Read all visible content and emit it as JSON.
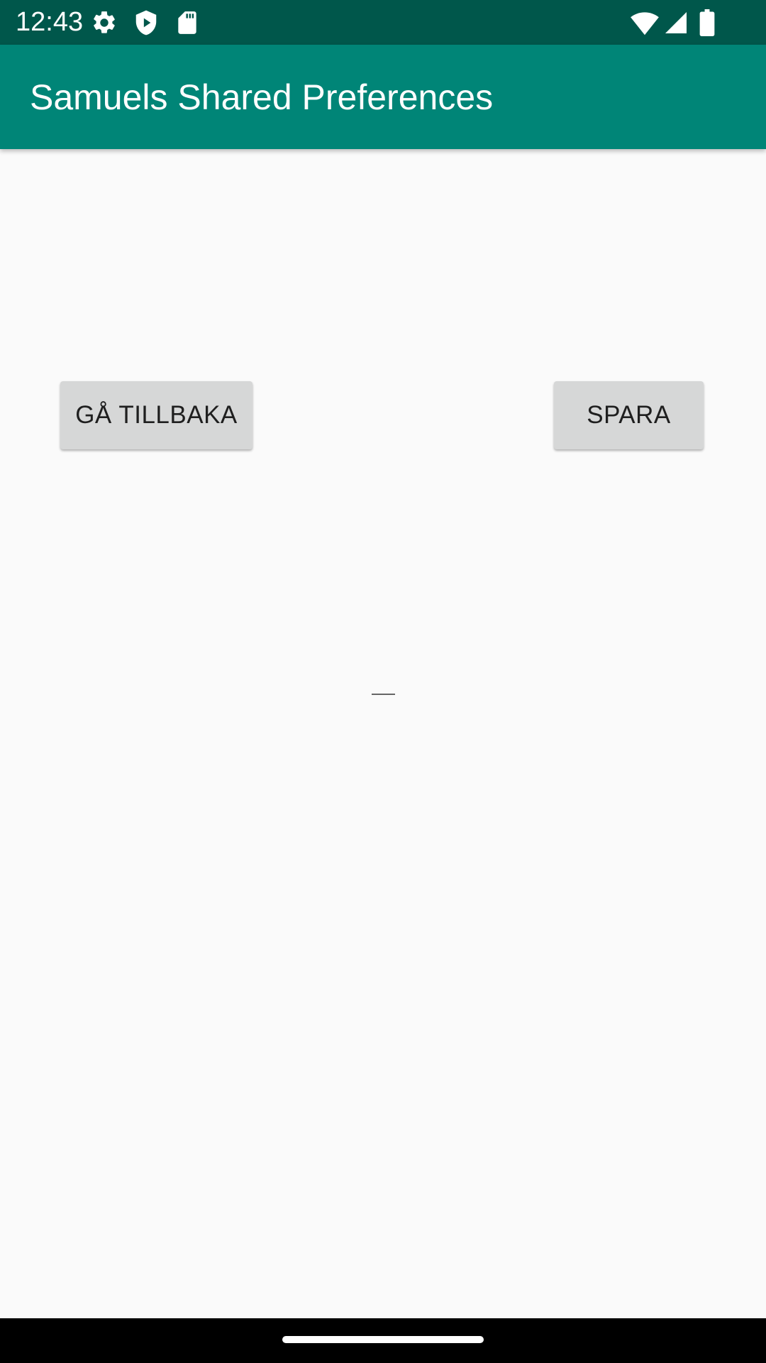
{
  "status_bar": {
    "time": "12:43",
    "left_icons": [
      "gear-icon",
      "shield-play-icon",
      "sd-card-icon"
    ],
    "right_icons": [
      "wifi-icon",
      "cell-signal-icon",
      "battery-icon"
    ],
    "background_color": "#00574b"
  },
  "app_bar": {
    "title": "Samuels Shared Preferences",
    "background_color": "#008577"
  },
  "main": {
    "back_button_label": "GÅ TILLBAKA",
    "save_button_label": "SPARA",
    "input_value": "",
    "button_color": "#d6d7d7"
  },
  "nav_bar": {
    "handle": "home-gesture-handle"
  }
}
